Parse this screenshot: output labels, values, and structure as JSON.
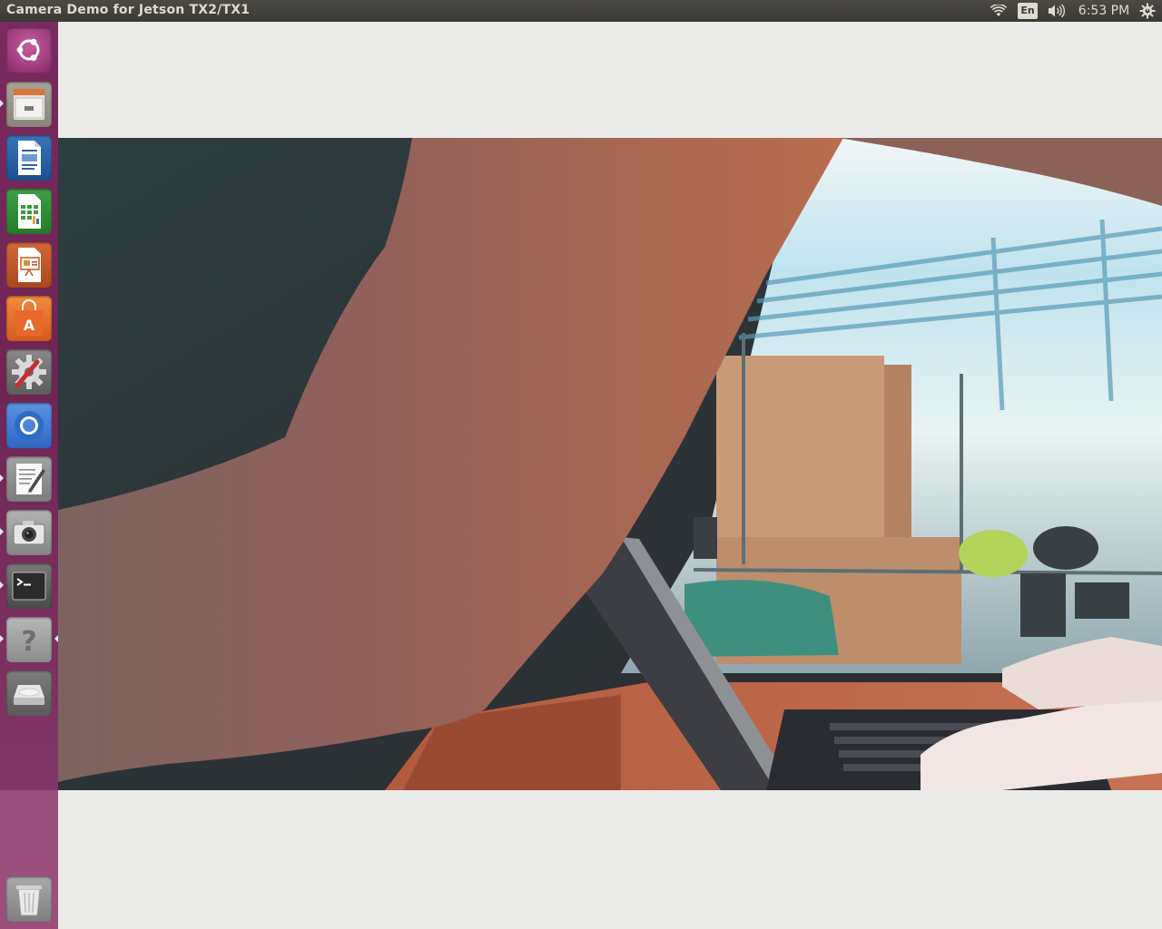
{
  "window": {
    "title": "Camera Demo for Jetson TX2/TX1"
  },
  "indicators": {
    "network_icon": "wifi-icon",
    "keyboard_language": "En",
    "sound_icon": "volume-icon",
    "clock": "6:53 PM",
    "session_icon": "power-gear-icon"
  },
  "colors": {
    "panel": "#3c3b37",
    "launcher": "#7a2a5d",
    "window_background": "#ebebea"
  },
  "launcher": {
    "items": [
      {
        "name": "ubuntu-dash-icon",
        "running": false
      },
      {
        "name": "files-icon",
        "running": true
      },
      {
        "name": "writer-icon",
        "running": false
      },
      {
        "name": "calc-icon",
        "running": false
      },
      {
        "name": "impress-icon",
        "running": false
      },
      {
        "name": "software-center-icon",
        "running": false
      },
      {
        "name": "system-settings-icon",
        "running": false
      },
      {
        "name": "chromium-icon",
        "running": false
      },
      {
        "name": "text-editor-icon",
        "running": true
      },
      {
        "name": "camera-icon",
        "running": true
      },
      {
        "name": "terminal-icon",
        "running": true
      },
      {
        "name": "help-icon",
        "running": true,
        "active": true
      },
      {
        "name": "disk-drive-icon",
        "running": false
      },
      {
        "name": "trash-icon",
        "running": false
      }
    ]
  },
  "camera_feed": {
    "content": "live-camera-image"
  }
}
